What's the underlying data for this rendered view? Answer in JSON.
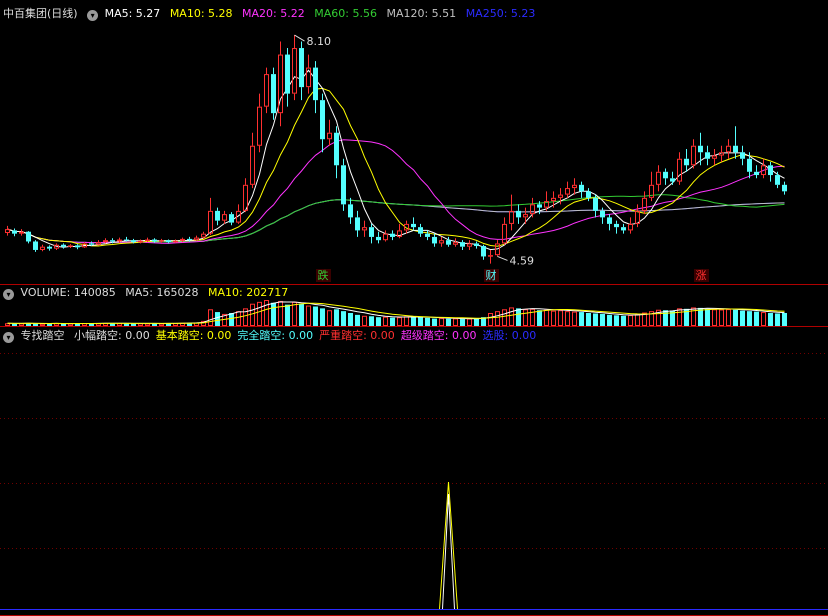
{
  "colors": {
    "up": "#ff3030",
    "down": "#54ffff",
    "bg": "#000000",
    "divider": "#b00000",
    "ma5": "#ffffff",
    "ma10": "#ffff00",
    "ma20": "#ff33ff",
    "ma60": "#33cc33",
    "ma120": "#c0c0c0",
    "ma250": "#2b2bff"
  },
  "price_legend": {
    "stock_name": "中百集团(日线)",
    "ma5": "MA5: 5.27",
    "ma10": "MA10: 5.28",
    "ma20": "MA20: 5.22",
    "ma60": "MA60: 5.56",
    "ma120": "MA120: 5.51",
    "ma250": "MA250: 5.23"
  },
  "volume_legend": {
    "volume": "VOLUME: 140085",
    "ma5": "MA5: 165028",
    "ma10": "MA10: 202717"
  },
  "indicator_legend": {
    "name": "专找踏空",
    "items": [
      {
        "text": "小幅踏空: 0.00",
        "color": "#dddddd"
      },
      {
        "text": "基本踏空: 0.00",
        "color": "#ffff00"
      },
      {
        "text": "完全踏空: 0.00",
        "color": "#54ffff"
      },
      {
        "text": "严重踏空: 0.00",
        "color": "#ff3030"
      },
      {
        "text": "超级踏空: 0.00",
        "color": "#ff33ff"
      },
      {
        "text": "选股: 0.00",
        "color": "#2b2bff"
      }
    ]
  },
  "badges": [
    {
      "label": "跌",
      "color": "#33cc33",
      "bar_index": 45
    },
    {
      "label": "财",
      "color": "#54ffff",
      "bar_index": 69
    },
    {
      "label": "涨",
      "color": "#ff3030",
      "bar_index": 99
    }
  ],
  "chart_data": {
    "type": "candlestick",
    "price_range": [
      4.4,
      8.3
    ],
    "high_marker": {
      "value": "8.10",
      "bar_index": 41
    },
    "low_marker": {
      "value": "4.59",
      "bar_index": 70
    },
    "candles": [
      [
        5.06,
        5.12,
        5.17,
        5.02
      ],
      [
        5.1,
        5.05,
        5.13,
        5.01
      ],
      [
        5.05,
        5.08,
        5.12,
        5.02
      ],
      [
        5.08,
        4.93,
        5.09,
        4.9
      ],
      [
        4.93,
        4.8,
        4.95,
        4.77
      ],
      [
        4.8,
        4.85,
        4.88,
        4.78
      ],
      [
        4.85,
        4.82,
        4.87,
        4.79
      ],
      [
        4.82,
        4.88,
        4.9,
        4.8
      ],
      [
        4.88,
        4.85,
        4.9,
        4.82
      ],
      [
        4.85,
        4.87,
        4.89,
        4.83
      ],
      [
        4.87,
        4.84,
        4.89,
        4.81
      ],
      [
        4.84,
        4.9,
        4.92,
        4.83
      ],
      [
        4.9,
        4.88,
        4.93,
        4.86
      ],
      [
        4.88,
        4.92,
        4.95,
        4.87
      ],
      [
        4.92,
        4.95,
        4.98,
        4.9
      ],
      [
        4.95,
        4.93,
        4.98,
        4.9
      ],
      [
        4.93,
        4.96,
        4.99,
        4.91
      ],
      [
        4.96,
        4.95,
        5.0,
        4.93
      ],
      [
        4.95,
        4.92,
        4.97,
        4.9
      ],
      [
        4.92,
        4.94,
        4.96,
        4.9
      ],
      [
        4.94,
        4.96,
        4.99,
        4.92
      ],
      [
        4.96,
        4.93,
        4.98,
        4.91
      ],
      [
        4.93,
        4.95,
        4.97,
        4.91
      ],
      [
        4.95,
        4.92,
        4.96,
        4.9
      ],
      [
        4.92,
        4.94,
        4.96,
        4.91
      ],
      [
        4.94,
        4.97,
        4.99,
        4.92
      ],
      [
        4.97,
        4.95,
        5.0,
        4.93
      ],
      [
        4.95,
        4.99,
        5.02,
        4.94
      ],
      [
        4.99,
        5.05,
        5.08,
        4.97
      ],
      [
        5.05,
        5.4,
        5.6,
        5.03
      ],
      [
        5.4,
        5.25,
        5.45,
        5.18
      ],
      [
        5.25,
        5.35,
        5.4,
        5.2
      ],
      [
        5.35,
        5.22,
        5.38,
        5.18
      ],
      [
        5.22,
        5.4,
        5.5,
        5.2
      ],
      [
        5.4,
        5.8,
        5.9,
        5.38
      ],
      [
        5.8,
        6.4,
        6.6,
        5.75
      ],
      [
        6.4,
        7.0,
        7.2,
        6.3
      ],
      [
        7.0,
        7.5,
        7.6,
        6.9
      ],
      [
        7.5,
        6.9,
        7.6,
        6.8
      ],
      [
        6.9,
        7.8,
        8.0,
        6.7
      ],
      [
        7.8,
        7.2,
        7.9,
        7.0
      ],
      [
        7.2,
        7.9,
        8.1,
        7.1
      ],
      [
        7.9,
        7.3,
        8.0,
        7.1
      ],
      [
        7.3,
        7.6,
        7.8,
        7.2
      ],
      [
        7.6,
        7.1,
        7.7,
        6.9
      ],
      [
        7.1,
        6.5,
        7.2,
        6.3
      ],
      [
        6.5,
        6.6,
        6.8,
        6.4
      ],
      [
        6.6,
        6.1,
        6.7,
        5.9
      ],
      [
        6.1,
        5.5,
        6.2,
        5.4
      ],
      [
        5.5,
        5.3,
        5.6,
        5.2
      ],
      [
        5.3,
        5.1,
        5.4,
        5.0
      ],
      [
        5.1,
        5.15,
        5.25,
        5.0
      ],
      [
        5.15,
        5.0,
        5.2,
        4.9
      ],
      [
        5.0,
        4.95,
        5.08,
        4.9
      ],
      [
        4.95,
        5.05,
        5.1,
        4.93
      ],
      [
        5.05,
        5.0,
        5.1,
        4.95
      ],
      [
        5.0,
        5.1,
        5.2,
        4.98
      ],
      [
        5.1,
        5.2,
        5.25,
        5.05
      ],
      [
        5.2,
        5.15,
        5.3,
        5.1
      ],
      [
        5.15,
        5.05,
        5.2,
        5.0
      ],
      [
        5.05,
        5.0,
        5.1,
        4.95
      ],
      [
        5.0,
        4.9,
        5.05,
        4.85
      ],
      [
        4.9,
        4.95,
        5.0,
        4.85
      ],
      [
        4.95,
        4.88,
        5.0,
        4.85
      ],
      [
        4.88,
        4.92,
        4.98,
        4.85
      ],
      [
        4.92,
        4.85,
        4.95,
        4.8
      ],
      [
        4.85,
        4.9,
        4.95,
        4.8
      ],
      [
        4.9,
        4.86,
        4.93,
        4.82
      ],
      [
        4.86,
        4.7,
        4.88,
        4.65
      ],
      [
        4.7,
        4.72,
        4.8,
        4.59
      ],
      [
        4.72,
        4.9,
        4.95,
        4.7
      ],
      [
        4.9,
        5.2,
        5.3,
        4.88
      ],
      [
        5.2,
        5.4,
        5.65,
        5.1
      ],
      [
        5.4,
        5.3,
        5.5,
        5.2
      ],
      [
        5.3,
        5.35,
        5.45,
        5.2
      ],
      [
        5.35,
        5.5,
        5.6,
        5.3
      ],
      [
        5.5,
        5.45,
        5.55,
        5.35
      ],
      [
        5.45,
        5.55,
        5.7,
        5.4
      ],
      [
        5.55,
        5.6,
        5.7,
        5.45
      ],
      [
        5.6,
        5.65,
        5.75,
        5.5
      ],
      [
        5.65,
        5.75,
        5.85,
        5.6
      ],
      [
        5.75,
        5.8,
        5.9,
        5.65
      ],
      [
        5.8,
        5.7,
        5.85,
        5.6
      ],
      [
        5.7,
        5.6,
        5.75,
        5.55
      ],
      [
        5.6,
        5.4,
        5.65,
        5.3
      ],
      [
        5.4,
        5.3,
        5.45,
        5.2
      ],
      [
        5.3,
        5.2,
        5.35,
        5.1
      ],
      [
        5.2,
        5.15,
        5.25,
        5.05
      ],
      [
        5.15,
        5.1,
        5.2,
        5.05
      ],
      [
        5.1,
        5.2,
        5.3,
        5.05
      ],
      [
        5.2,
        5.4,
        5.5,
        5.15
      ],
      [
        5.4,
        5.6,
        5.7,
        5.35
      ],
      [
        5.6,
        5.8,
        6.0,
        5.55
      ],
      [
        5.8,
        6.0,
        6.1,
        5.7
      ],
      [
        6.0,
        5.9,
        6.05,
        5.8
      ],
      [
        5.9,
        5.85,
        6.0,
        5.8
      ],
      [
        5.85,
        6.2,
        6.3,
        5.8
      ],
      [
        6.2,
        6.1,
        6.35,
        6.0
      ],
      [
        6.1,
        6.4,
        6.5,
        6.05
      ],
      [
        6.4,
        6.3,
        6.6,
        6.1
      ],
      [
        6.3,
        6.2,
        6.4,
        6.1
      ],
      [
        6.2,
        6.25,
        6.35,
        6.1
      ],
      [
        6.25,
        6.3,
        6.4,
        6.15
      ],
      [
        6.3,
        6.4,
        6.5,
        6.2
      ],
      [
        6.4,
        6.3,
        6.7,
        6.2
      ],
      [
        6.3,
        6.2,
        6.4,
        6.1
      ],
      [
        6.2,
        6.0,
        6.3,
        5.9
      ],
      [
        6.0,
        5.95,
        6.1,
        5.9
      ],
      [
        5.95,
        6.1,
        6.2,
        5.9
      ],
      [
        6.1,
        5.95,
        6.15,
        5.85
      ],
      [
        5.95,
        5.8,
        6.0,
        5.75
      ],
      [
        5.8,
        5.7,
        5.85,
        5.65
      ]
    ],
    "volume": [
      30,
      25,
      28,
      32,
      27,
      24,
      26,
      29,
      25,
      27,
      26,
      30,
      28,
      29,
      31,
      27,
      30,
      28,
      26,
      29,
      27,
      28,
      26,
      29,
      31,
      33,
      35,
      38,
      55,
      180,
      150,
      130,
      140,
      160,
      190,
      240,
      260,
      280,
      250,
      270,
      230,
      260,
      240,
      220,
      210,
      190,
      170,
      180,
      160,
      140,
      120,
      110,
      105,
      95,
      100,
      90,
      95,
      105,
      100,
      92,
      88,
      80,
      85,
      78,
      82,
      75,
      80,
      78,
      95,
      140,
      160,
      180,
      200,
      190,
      180,
      185,
      170,
      175,
      165,
      170,
      160,
      155,
      150,
      140,
      135,
      130,
      120,
      115,
      110,
      118,
      130,
      145,
      160,
      175,
      170,
      165,
      190,
      185,
      200,
      195,
      185,
      180,
      178,
      182,
      175,
      165,
      160,
      155,
      150,
      140,
      135,
      140
    ],
    "indicator": {
      "spike_bar_index": 63,
      "spike_value": 1,
      "baseline": 0
    }
  }
}
